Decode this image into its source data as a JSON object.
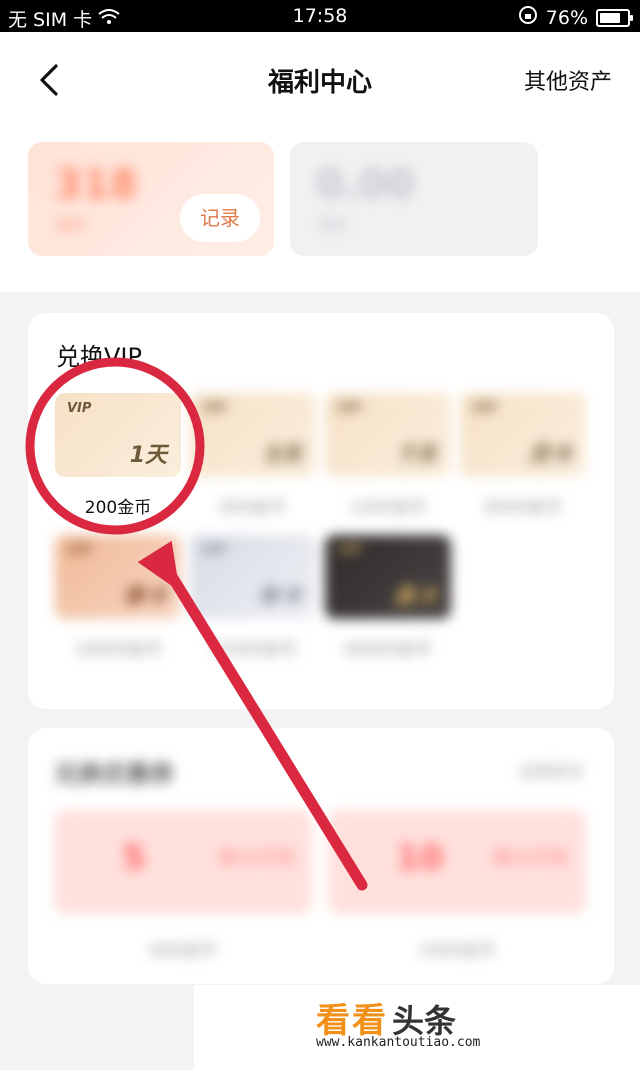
{
  "status_bar": {
    "carrier": "无 SIM 卡",
    "time": "17:58",
    "battery": "76%",
    "battery_level": 0.76,
    "icons": [
      "wifi-icon",
      "rotation-lock-icon",
      "battery-icon"
    ]
  },
  "header": {
    "title": "福利中心",
    "right_action": "其他资产",
    "back_icon": "chevron-left-icon"
  },
  "balances": {
    "coins_value": "318",
    "coins_label": "金币",
    "record_button": "记录",
    "cash_value": "0.00",
    "cash_label": "现金"
  },
  "vip": {
    "section_title": "兑换VIP",
    "items": [
      {
        "tag": "VIP",
        "duration": "1天",
        "price": "200金币"
      },
      {
        "tag": "VIP",
        "duration": "3天",
        "price": "600金币"
      },
      {
        "tag": "VIP",
        "duration": "7天",
        "price": "1400金币"
      },
      {
        "tag": "VIP",
        "duration": "月卡",
        "price": "6000金币"
      },
      {
        "tag": "VIP",
        "duration": "季卡",
        "price": "18000金币"
      },
      {
        "tag": "VIP",
        "duration": "年卡",
        "price": "72000金币"
      },
      {
        "tag": "VIP",
        "duration": "黑卡",
        "price": "98000金币"
      }
    ]
  },
  "tasks": {
    "section_title": "兑换优惠券",
    "section_link": "查看更多",
    "items": [
      {
        "big": "5",
        "small": "满30可用",
        "label": "600金币"
      },
      {
        "big": "10",
        "small": "满50可用",
        "label": "1000金币"
      }
    ]
  },
  "watermark": {
    "brand_orange": "看看",
    "brand_dark": "头条",
    "url": "www.kankantoutiao.com"
  },
  "colors": {
    "annotation_red": "#d9283f",
    "watermark_orange": "#f39019"
  }
}
